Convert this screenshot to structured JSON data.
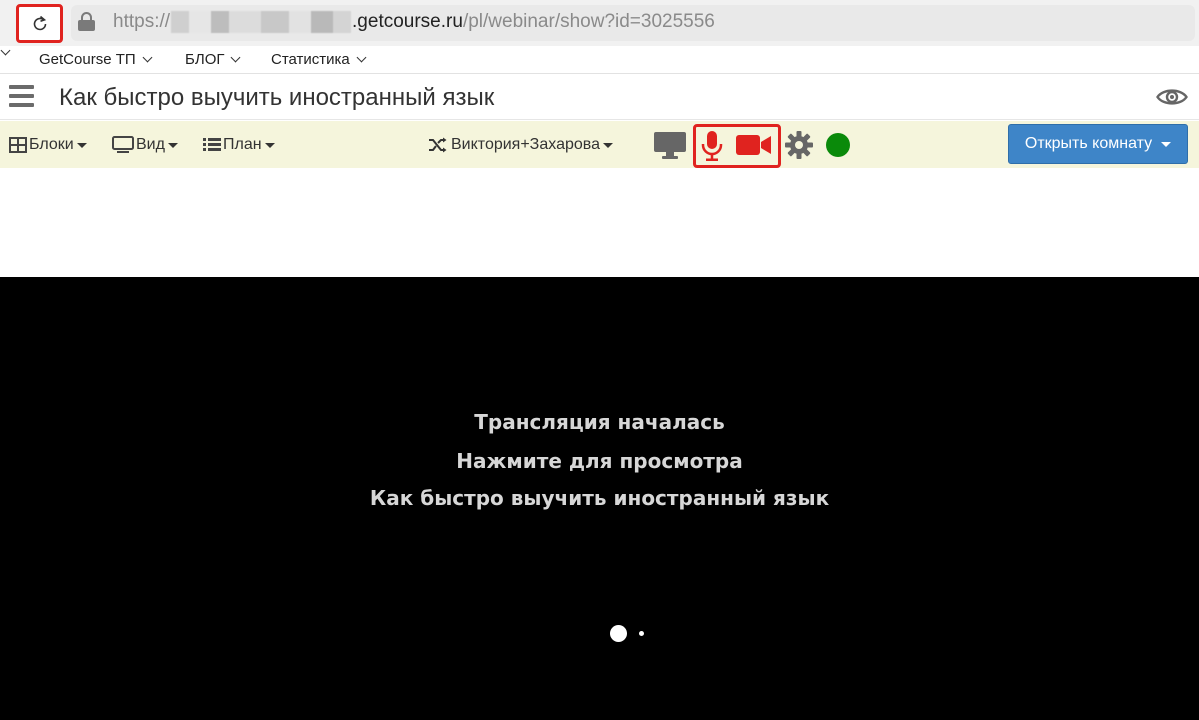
{
  "browser": {
    "url_prefix": "https://",
    "url_domain": ".getcourse.ru",
    "url_path": "/pl/webinar/show?id=3025556"
  },
  "bookmarks": {
    "items": [
      {
        "label": "GetCourse ТП"
      },
      {
        "label": "БЛОГ"
      },
      {
        "label": "Статистика"
      }
    ]
  },
  "page": {
    "title": "Как быстро выучить иностранный язык"
  },
  "toolbar": {
    "blocks_label": "Блоки",
    "view_label": "Вид",
    "plan_label": "План",
    "presenter_label": "Виктория+Захарова",
    "open_room_label": "Открыть комнату",
    "status_color": "#0a8a0a",
    "accent_red": "#e0231f",
    "button_color": "#3e85c8"
  },
  "video": {
    "line1": "Трансляция началась",
    "line2": "Нажмите для просмотра",
    "line3": "Как быстро выучить иностранный язык"
  }
}
